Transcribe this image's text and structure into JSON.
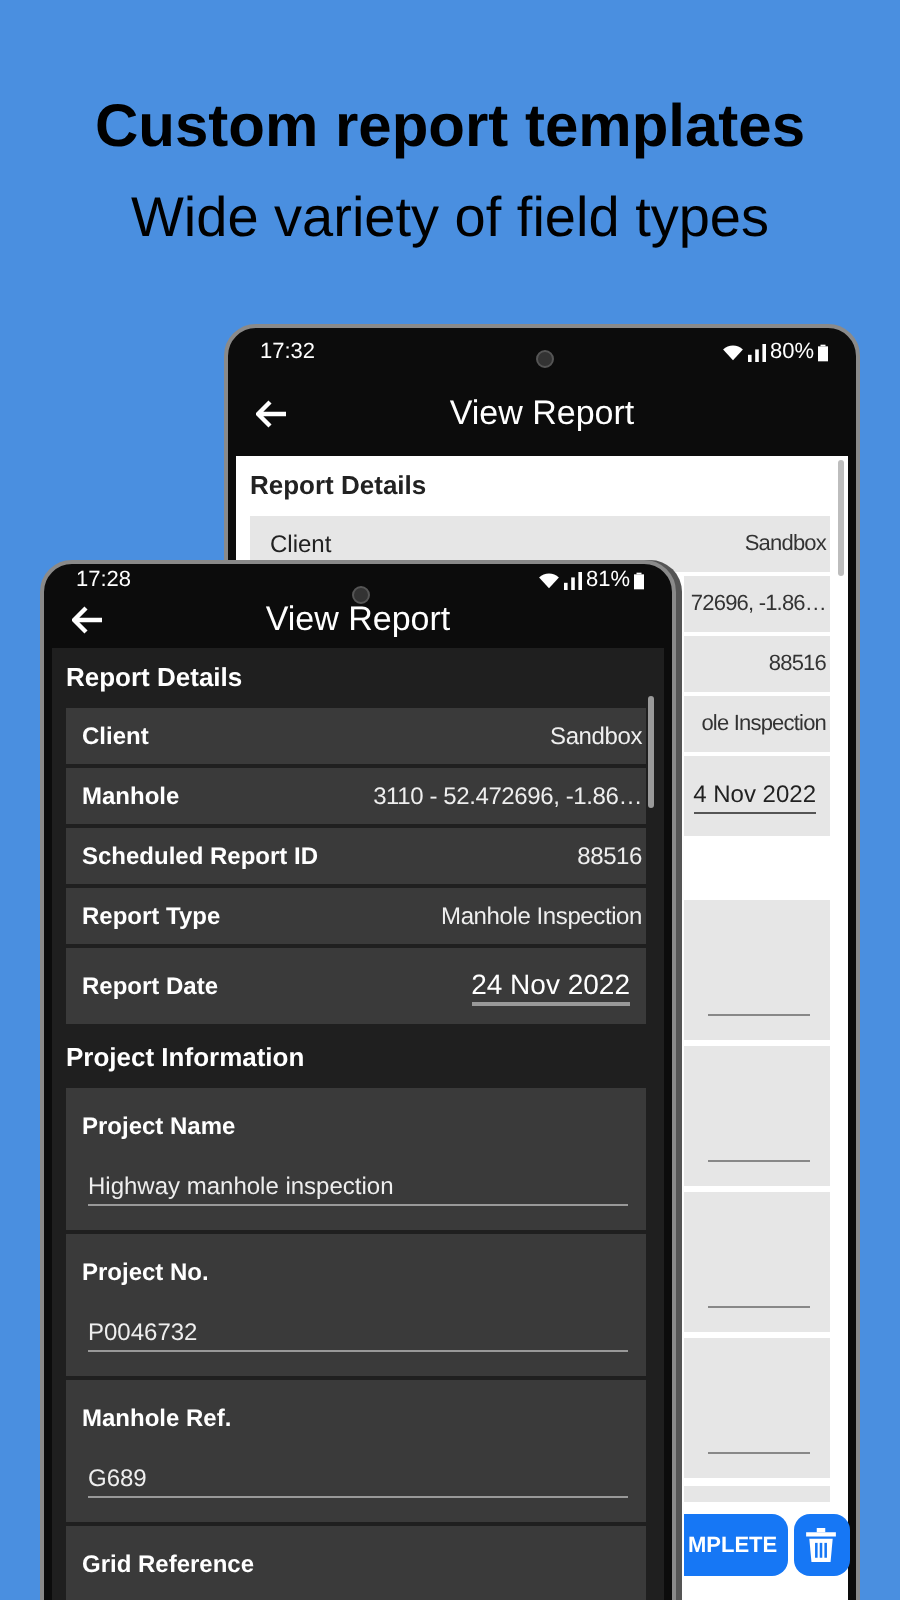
{
  "headline": "Custom report templates",
  "subheadline": "Wide variety of field types",
  "back_phone": {
    "status_bar": {
      "time": "17:32",
      "battery": "80%"
    },
    "title": "View Report",
    "section": {
      "title": "Report Details",
      "rows": [
        {
          "kind": "text",
          "label": "Client",
          "value": "Sandbox"
        },
        {
          "kind": "text",
          "value": "72696, -1.86…"
        },
        {
          "kind": "text",
          "value": "88516"
        },
        {
          "kind": "text",
          "value": "ole Inspection"
        },
        {
          "kind": "date",
          "value": "4 Nov 2022"
        }
      ]
    },
    "buttons": [
      {
        "kind": "primary",
        "label": "MPLETE"
      },
      {
        "kind": "delete"
      }
    ]
  },
  "front_phone": {
    "status_bar": {
      "time": "17:28",
      "battery": "81%"
    },
    "title": "View Report",
    "sections": [
      {
        "title": "Report Details",
        "rows": [
          {
            "kind": "text",
            "label": "Client",
            "value": "Sandbox"
          },
          {
            "kind": "text",
            "label": "Manhole",
            "value": "3110 - 52.472696, -1.86…"
          },
          {
            "kind": "text",
            "label": "Scheduled Report ID",
            "value": "88516"
          },
          {
            "kind": "text",
            "label": "Report Type",
            "value": "Manhole Inspection"
          },
          {
            "kind": "date",
            "label": "Report Date",
            "value": "24 Nov 2022"
          }
        ]
      },
      {
        "title": "Project Information",
        "fields": [
          {
            "label": "Project Name",
            "value": "Highway manhole inspection"
          },
          {
            "label": "Project No.",
            "value": "P0046732"
          },
          {
            "label": "Manhole Ref.",
            "value": "G689"
          },
          {
            "label": "Grid Reference"
          }
        ]
      }
    ]
  }
}
